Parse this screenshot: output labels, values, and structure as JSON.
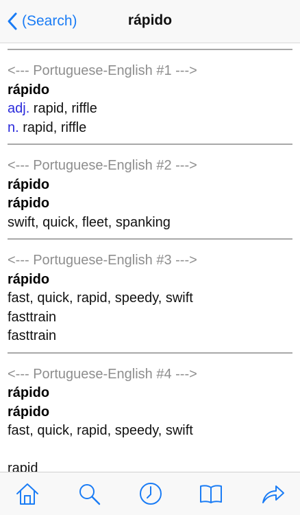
{
  "navbar": {
    "back_label": "(Search)",
    "title": "rápido",
    "accent_color": "#1a7cf5"
  },
  "entries": [
    {
      "header": "<--- Portuguese-English #1 --->",
      "headword": "rápido",
      "lines": [
        {
          "pos": "adj.",
          "text": " rapid, riffle"
        },
        {
          "pos": "n.",
          "text": " rapid, riffle"
        }
      ]
    },
    {
      "header": "<--- Portuguese-English #2 --->",
      "headword": "rápido",
      "headword2": "rápido",
      "lines": [
        "swift, quick, fleet, spanking"
      ]
    },
    {
      "header": "<--- Portuguese-English #3 --->",
      "headword": "rápido",
      "lines": [
        "fast, quick, rapid, speedy, swift",
        "fasttrain",
        "fasttrain"
      ]
    },
    {
      "header": "<--- Portuguese-English #4 --->",
      "headword": "rápido",
      "headword2": "rápido",
      "lines": [
        "fast, quick, rapid, speedy, swift",
        "",
        "rapid"
      ]
    }
  ],
  "tabbar": {
    "icons": [
      "home-icon",
      "search-icon",
      "history-clock-icon",
      "book-icon",
      "share-arrow-icon"
    ]
  }
}
